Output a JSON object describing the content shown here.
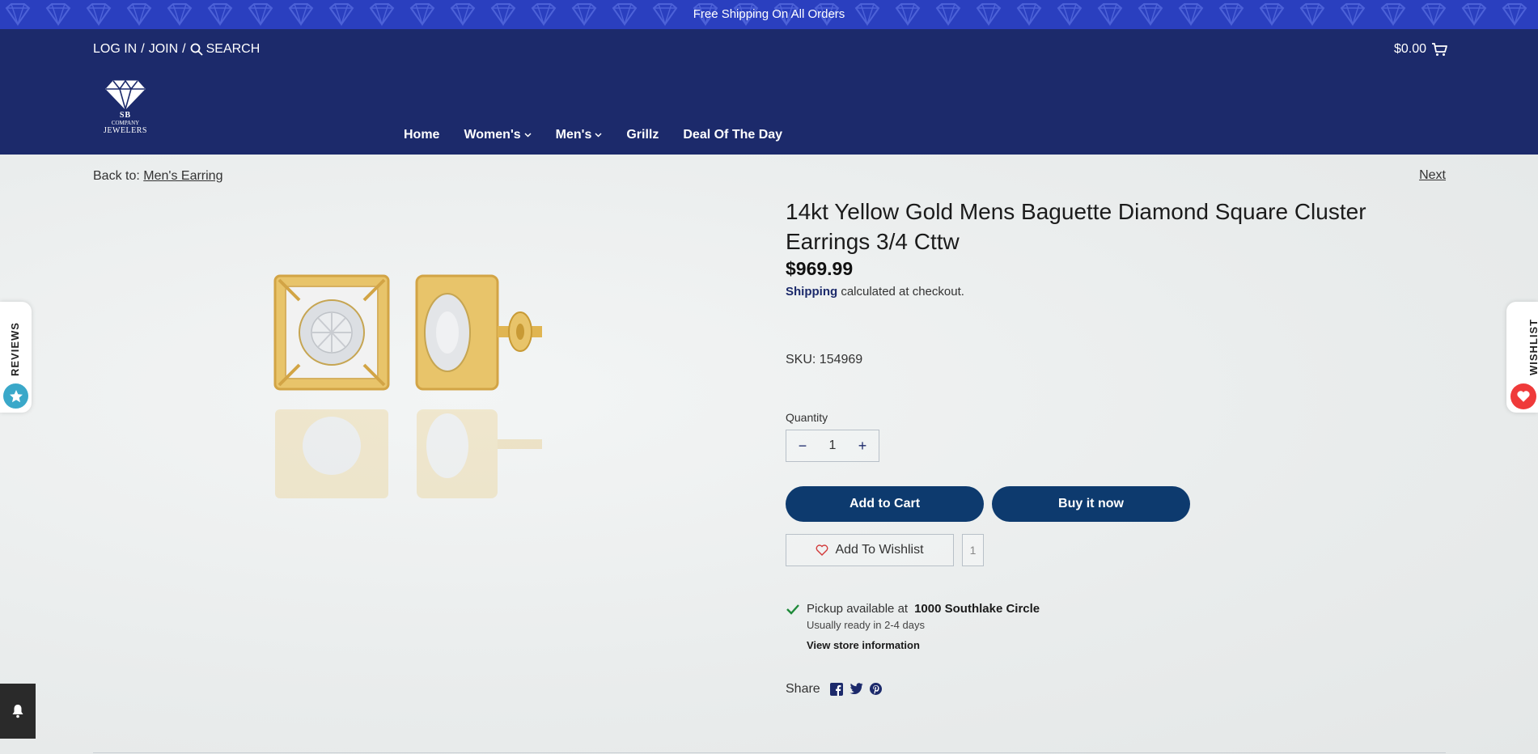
{
  "announcement": {
    "text": "Free Shipping On All Orders"
  },
  "header": {
    "login_label": "LOG IN",
    "sep1": "/",
    "join_label": "JOIN",
    "sep2": "/",
    "search_label": "SEARCH",
    "cart_total": "$0.00",
    "logo": {
      "sb": "SB",
      "company": "COMPANY",
      "jewelers": "JEWELERS"
    }
  },
  "nav": {
    "items": [
      {
        "label": "Home"
      },
      {
        "label": "Women's"
      },
      {
        "label": "Men's"
      },
      {
        "label": "Grillz"
      },
      {
        "label": "Deal Of The Day"
      }
    ]
  },
  "breadcrumb": {
    "prefix": "Back to:",
    "link": "Men's Earring",
    "next": "Next"
  },
  "product": {
    "title": "14kt Yellow Gold Mens Baguette Diamond Square Cluster Earrings 3/4 Cttw",
    "price": "$969.99",
    "shipping_link": "Shipping",
    "shipping_text": "calculated at checkout.",
    "sku": "SKU: 154969",
    "quantity_label": "Quantity",
    "quantity_value": "1",
    "minus": "−",
    "plus": "+",
    "add_to_cart": "Add to Cart",
    "buy_now": "Buy it now",
    "wishlist_label": "Add To Wishlist",
    "wishlist_count": "1"
  },
  "pickup": {
    "text": "Pickup available at",
    "location": "1000 Southlake Circle",
    "ready": "Usually ready in 2-4 days",
    "store_info": "View store information"
  },
  "share": {
    "label": "Share"
  },
  "side": {
    "reviews": "REVIEWS",
    "wishlist": "WISHLIST"
  },
  "colors": {
    "header_bg": "#1c2a6b",
    "announce_bg": "#2a3fbf",
    "button_bg": "#0d3a6e",
    "reviews_accent": "#3aa8c9",
    "wishlist_accent": "#ef3a3a"
  }
}
